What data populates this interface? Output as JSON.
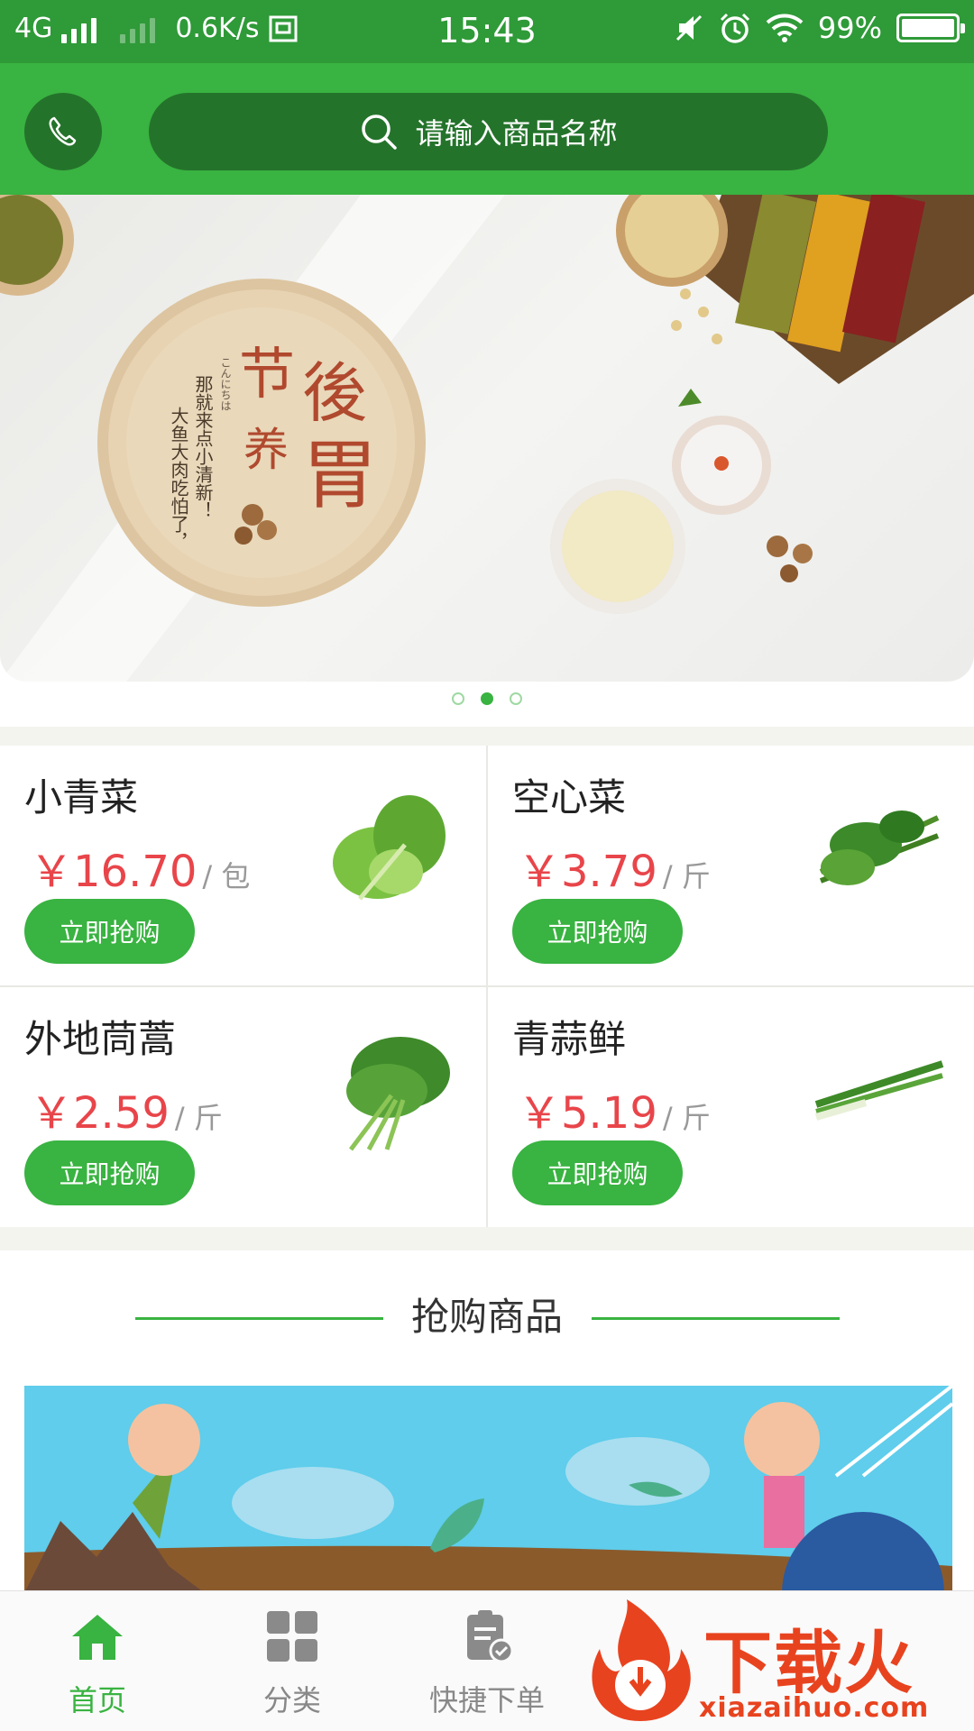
{
  "status_bar": {
    "network": "4G",
    "speed": "0.6K/s",
    "time": "15:43",
    "battery": "99%"
  },
  "header": {
    "search_placeholder": "请输入商品名称",
    "phone_icon": "phone-icon",
    "search_icon": "search-icon"
  },
  "banner": {
    "headline_1": "节",
    "headline_2": "後",
    "headline_3": "养",
    "headline_4": "胃",
    "kana": "こんにちは",
    "tagline_1": "那就来点小清新！",
    "tagline_2": "大鱼大肉吃怕了，",
    "dots_count": 3,
    "active_dot": 2
  },
  "products": [
    {
      "name": "小青菜",
      "price": "￥16.70",
      "unit": "/ 包",
      "button": "立即抢购"
    },
    {
      "name": "空心菜",
      "price": "￥3.79",
      "unit": "/ 斤",
      "button": "立即抢购"
    },
    {
      "name": "外地茼蒿",
      "price": "￥2.59",
      "unit": "/ 斤",
      "button": "立即抢购"
    },
    {
      "name": "青蒜鲜",
      "price": "￥5.19",
      "unit": "/ 斤",
      "button": "立即抢购"
    }
  ],
  "section": {
    "title": "抢购商品"
  },
  "bottom_nav": [
    {
      "label": "首页",
      "icon": "home-icon",
      "active": true
    },
    {
      "label": "分类",
      "icon": "grid-icon",
      "active": false
    },
    {
      "label": "快捷下单",
      "icon": "clipboard-check-icon",
      "active": false
    }
  ],
  "watermark": {
    "text": "下载火",
    "domain": "xiazaihuo.com"
  },
  "colors": {
    "brand_green": "#39b341",
    "dark_green": "#24732b",
    "price_red": "#e8454a"
  }
}
